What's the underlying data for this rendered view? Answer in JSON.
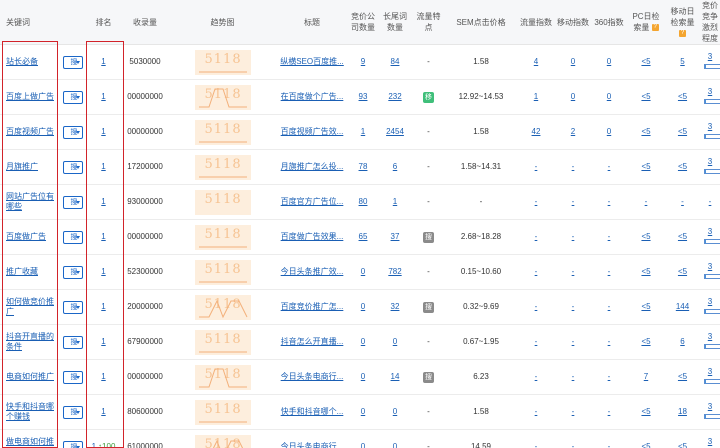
{
  "headers": {
    "keyword": "关键词",
    "rank": "排名",
    "indexed": "收录量",
    "trend": "趋势图",
    "title": "标题",
    "bid_count": "竞价公司数量",
    "longtail": "长尾词数量",
    "traffic_feature": "流量特点",
    "sem_price": "SEM点击价格",
    "traffic_index": "流量指数",
    "mobile_index": "移动指数",
    "index360": "360指数",
    "pc_search": "PC日检索量",
    "mobile_search": "移动日检索量",
    "competition": "竞价竞争激烈程度"
  },
  "select_label": "搜",
  "tooltip_icon": "?",
  "watermark": "5118",
  "rows": [
    {
      "keyword": "站长必备",
      "rank": "1",
      "indexed": "5030000",
      "title": "纵横SEO百度推...",
      "bid": "9",
      "longtail": "84",
      "feature": "-",
      "feature_badge": "",
      "sem": "1.58",
      "ti": "4",
      "mi": "0",
      "i360": "0",
      "pc": "<5",
      "mob": "5",
      "comp": "3",
      "comp_level": 0.05,
      "trend": "flat"
    },
    {
      "keyword": "百度上做广告",
      "rank": "1",
      "indexed": "00000000",
      "title": "在百度做个广告...",
      "bid": "93",
      "longtail": "232",
      "feature": "",
      "feature_badge": "移",
      "sem": "12.92~14.53",
      "ti": "1",
      "mi": "0",
      "i360": "0",
      "pc": "<5",
      "mob": "<5",
      "comp": "3",
      "comp_level": 0.05,
      "trend": "spike"
    },
    {
      "keyword": "百度视频广告",
      "rank": "1",
      "indexed": "00000000",
      "title": "百度视频广告效...",
      "bid": "1",
      "longtail": "2454",
      "feature": "-",
      "feature_badge": "",
      "sem": "1.58",
      "ti": "42",
      "mi": "2",
      "i360": "0",
      "pc": "<5",
      "mob": "<5",
      "comp": "3",
      "comp_level": 0.05,
      "trend": "flat"
    },
    {
      "keyword": "月旗推广",
      "rank": "1",
      "indexed": "17200000",
      "title": "月旗推广怎么投...",
      "bid": "78",
      "longtail": "6",
      "feature": "-",
      "feature_badge": "",
      "sem": "1.58~14.31",
      "ti": "-",
      "mi": "-",
      "i360": "-",
      "pc": "<5",
      "mob": "<5",
      "comp": "3",
      "comp_level": 0.05,
      "trend": "flat"
    },
    {
      "keyword": "网站广告位有哪些",
      "rank": "1",
      "indexed": "93000000",
      "title": "百度官方广告位...",
      "bid": "80",
      "longtail": "1",
      "feature": "-",
      "feature_badge": "",
      "sem": "-",
      "ti": "-",
      "mi": "-",
      "i360": "-",
      "pc": "-",
      "mob": "-",
      "comp": "-",
      "comp_level": 0,
      "trend": "flat_small"
    },
    {
      "keyword": "百度做广告",
      "rank": "1",
      "indexed": "00000000",
      "title": "百度做广告效果...",
      "bid": "65",
      "longtail": "37",
      "feature": "",
      "feature_badge": "搜",
      "sem": "2.68~18.28",
      "ti": "-",
      "mi": "-",
      "i360": "-",
      "pc": "<5",
      "mob": "<5",
      "comp": "3",
      "comp_level": 0.05,
      "trend": "flat"
    },
    {
      "keyword": "推广收藏",
      "rank": "1",
      "indexed": "52300000",
      "title": "今日头条推广效...",
      "bid": "0",
      "longtail": "782",
      "feature": "-",
      "feature_badge": "",
      "sem": "0.15~10.60",
      "ti": "-",
      "mi": "-",
      "i360": "-",
      "pc": "<5",
      "mob": "<5",
      "comp": "3",
      "comp_level": 0.05,
      "trend": "flat"
    },
    {
      "keyword": "如何做竞价推广",
      "rank": "1",
      "indexed": "20000000",
      "title": "百度竞价推广怎...",
      "bid": "0",
      "longtail": "32",
      "feature": "",
      "feature_badge": "搜",
      "sem": "0.32~9.69",
      "ti": "-",
      "mi": "-",
      "i360": "-",
      "pc": "<5",
      "mob": "144",
      "comp": "3",
      "comp_level": 0.05,
      "trend": "wave"
    },
    {
      "keyword": "抖音开直播的条件",
      "rank": "1",
      "indexed": "67900000",
      "title": "抖音怎么开直播...",
      "bid": "0",
      "longtail": "0",
      "feature": "-",
      "feature_badge": "",
      "sem": "0.67~1.95",
      "ti": "-",
      "mi": "-",
      "i360": "-",
      "pc": "<5",
      "mob": "6",
      "comp": "3",
      "comp_level": 0.05,
      "trend": "flat"
    },
    {
      "keyword": "电商如何推广",
      "rank": "1",
      "indexed": "00000000",
      "title": "今日头条电商行...",
      "bid": "0",
      "longtail": "14",
      "feature": "",
      "feature_badge": "搜",
      "sem": "6.23",
      "ti": "-",
      "mi": "-",
      "i360": "-",
      "pc": "7",
      "mob": "<5",
      "comp": "3",
      "comp_level": 0.05,
      "trend": "spike"
    },
    {
      "keyword": "快手和抖音哪个赚钱",
      "rank": "1",
      "indexed": "80600000",
      "title": "快手和抖音哪个...",
      "bid": "0",
      "longtail": "0",
      "feature": "-",
      "feature_badge": "",
      "sem": "1.58",
      "ti": "-",
      "mi": "-",
      "i360": "-",
      "pc": "<5",
      "mob": "18",
      "comp": "3",
      "comp_level": 0.05,
      "trend": "flat"
    },
    {
      "keyword": "做电商如何推广",
      "rank": "1",
      "rank_change": "↑100",
      "indexed": "61000000",
      "title": "今日头条电商行...",
      "bid": "0",
      "longtail": "0",
      "feature": "-",
      "feature_badge": "",
      "sem": "14.59",
      "ti": "-",
      "mi": "-",
      "i360": "-",
      "pc": "<5",
      "mob": "<5",
      "comp": "3",
      "comp_level": 0.05,
      "trend": "wave"
    }
  ],
  "colors": {
    "link": "#1a5fb4",
    "highlight_border": "#d2232a",
    "badge_green": "#3fbf7a",
    "badge_gray": "#8a8a8a",
    "rank_up": "#3b9b3b"
  }
}
